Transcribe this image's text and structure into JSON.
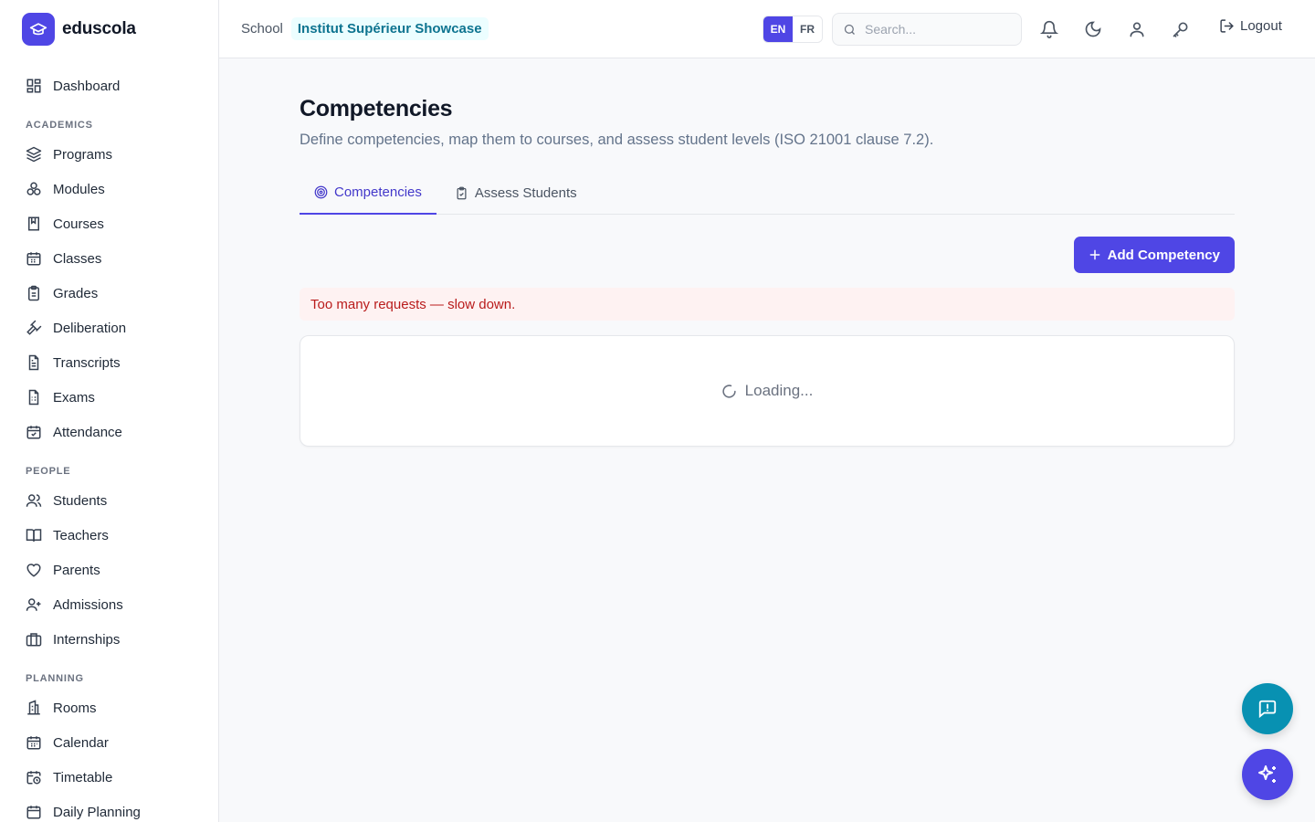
{
  "app": {
    "name": "eduscola"
  },
  "sidebar": {
    "dashboard": "Dashboard",
    "sections": {
      "academics": "ACADEMICS",
      "people": "PEOPLE",
      "planning": "PLANNING"
    },
    "academics_items": [
      {
        "label": "Programs",
        "icon": "layers-icon"
      },
      {
        "label": "Modules",
        "icon": "boxes-icon"
      },
      {
        "label": "Courses",
        "icon": "book-icon"
      },
      {
        "label": "Classes",
        "icon": "calendar-icon"
      },
      {
        "label": "Grades",
        "icon": "clipboard-icon"
      },
      {
        "label": "Deliberation",
        "icon": "gavel-icon"
      },
      {
        "label": "Transcripts",
        "icon": "file-text-icon"
      },
      {
        "label": "Exams",
        "icon": "file-list-icon"
      },
      {
        "label": "Attendance",
        "icon": "calendar-check-icon"
      }
    ],
    "people_items": [
      {
        "label": "Students",
        "icon": "users-icon"
      },
      {
        "label": "Teachers",
        "icon": "book-open-icon"
      },
      {
        "label": "Parents",
        "icon": "heart-icon"
      },
      {
        "label": "Admissions",
        "icon": "user-plus-icon"
      },
      {
        "label": "Internships",
        "icon": "briefcase-icon"
      }
    ],
    "planning_items": [
      {
        "label": "Rooms",
        "icon": "building-icon"
      },
      {
        "label": "Calendar",
        "icon": "calendar-icon"
      },
      {
        "label": "Timetable",
        "icon": "calendar-clock-icon"
      },
      {
        "label": "Daily Planning",
        "icon": "calendar-icon"
      }
    ]
  },
  "header": {
    "school_label": "School",
    "school_name": "Institut Supérieur Showcase",
    "lang_en": "EN",
    "lang_fr": "FR",
    "search_placeholder": "Search...",
    "logout_label": "Logout"
  },
  "main": {
    "title": "Competencies",
    "subtitle": "Define competencies, map them to courses, and assess student levels (ISO 21001 clause 7.2).",
    "tabs": [
      {
        "label": "Competencies",
        "active": true
      },
      {
        "label": "Assess Students",
        "active": false
      }
    ],
    "add_button": "Add Competency",
    "error_message": "Too many requests — slow down.",
    "loading_text": "Loading..."
  },
  "colors": {
    "primary": "#4f46e5",
    "accent_teal": "#0891b2",
    "error_bg": "#fef2f2",
    "error_text": "#b91c1c"
  }
}
